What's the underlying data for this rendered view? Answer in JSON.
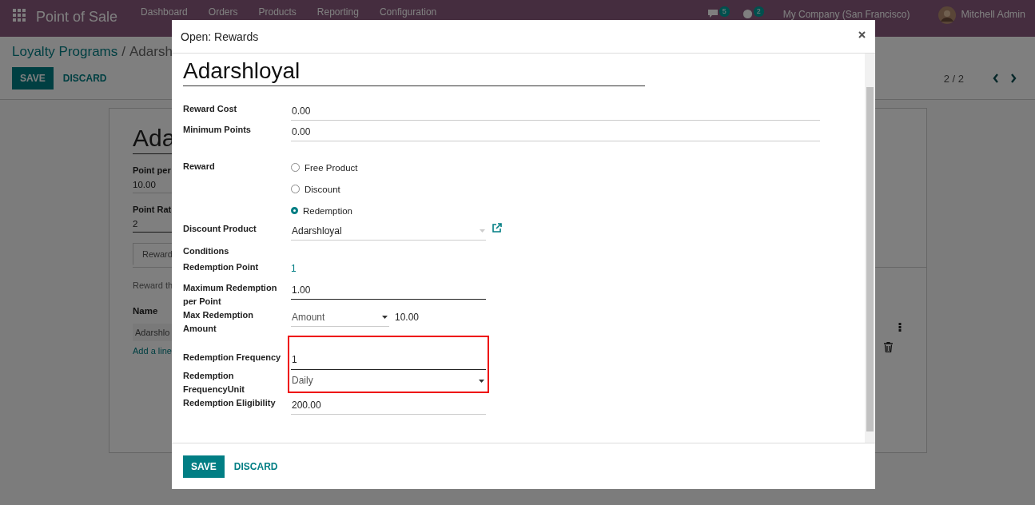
{
  "app": {
    "title": "Point of Sale",
    "menu": [
      "Dashboard",
      "Orders",
      "Products",
      "Reporting",
      "Configuration"
    ],
    "chat_badge": "5",
    "activity_badge": "2",
    "company": "My Company (San Francisco)",
    "user": "Mitchell Admin"
  },
  "breadcrumb": {
    "parent": "Loyalty Programs",
    "separator": "/",
    "current": "Adarsh"
  },
  "actions": [
    "SAVE",
    "DISCARD"
  ],
  "pager": "2 / 2",
  "sheet": {
    "name": "Ada",
    "fields": [
      {
        "label": "Point per",
        "value": "10.00",
        "required": false
      },
      {
        "label": "Point Rat",
        "value": "2",
        "required": true
      }
    ],
    "tab": "Reward",
    "note": "Reward th",
    "column": "Name",
    "row": "Adarshlo",
    "add_line": "Add a line"
  },
  "dialog": {
    "title": "Open: Rewards",
    "name": "Adarshloyal",
    "top_fields": [
      {
        "label": "Reward Cost",
        "value": "0.00"
      },
      {
        "label": "Minimum Points",
        "value": "0.00"
      }
    ],
    "fields": [
      {
        "kind": "radio",
        "label": "Reward",
        "options": [
          {
            "label": "Free Product",
            "selected": false
          },
          {
            "label": "Discount",
            "selected": false
          },
          {
            "label": "Redemption",
            "selected": true
          }
        ]
      },
      {
        "kind": "many2one",
        "label": "Discount Product",
        "value": "Adarshloyal"
      },
      {
        "kind": "section",
        "label": "Conditions"
      },
      {
        "kind": "readonly",
        "label": "Redemption Point",
        "value": "1"
      },
      {
        "kind": "input",
        "label": "Maximum Redemption per Point",
        "value": "1.00",
        "required": true
      },
      {
        "kind": "amount",
        "label": "Max Redemption Amount",
        "type": "Amount",
        "value": "10.00"
      },
      {
        "kind": "highlight",
        "fields": [
          {
            "kind": "input",
            "label": "Redemption Frequency",
            "value": "1",
            "required": true
          },
          {
            "kind": "select",
            "label": "Redemption FrequencyUnit",
            "value": "Daily"
          }
        ]
      },
      {
        "kind": "input",
        "label": "Redemption Eligibility",
        "value": "200.00",
        "required": false
      }
    ],
    "buttons": [
      "SAVE",
      "DISCARD"
    ]
  }
}
